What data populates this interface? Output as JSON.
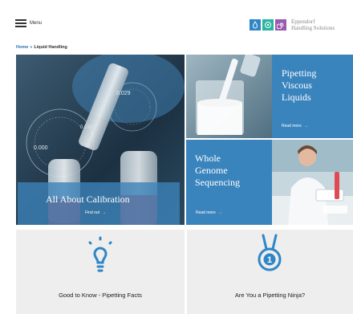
{
  "header": {
    "menu_label": "Menu",
    "brand_line1": "Eppendorf",
    "brand_line2": "Handling Solutions",
    "brand_colors": [
      "#2f86c6",
      "#2bb5a0",
      "#9b5bb0"
    ],
    "brand_icons": [
      "drop-icon",
      "target-icon",
      "spiral-icon"
    ]
  },
  "breadcrumb": {
    "home": "Home",
    "separator": "»",
    "current": "Liquid Handling"
  },
  "tiles": {
    "calibration": {
      "title": "All About Calibration",
      "link": "Find out",
      "arrow": "→"
    },
    "viscous": {
      "title_line1": "Pipetting",
      "title_line2": "Viscous",
      "title_line3": "Liquids",
      "link": "Read more",
      "arrow": "→"
    },
    "sequencing": {
      "title_line1": "Whole",
      "title_line2": "Genome",
      "title_line3": "Sequencing",
      "link": "Read more",
      "arrow": "→"
    }
  },
  "cards": {
    "facts": {
      "label": "Good to Know - Pipetting Facts",
      "icon": "lightbulb-icon"
    },
    "ninja": {
      "label": "Are You a Pipetting Ninja?",
      "icon": "medal-icon",
      "medal_number": "1"
    }
  },
  "colors": {
    "accent": "#3a84bd",
    "link": "#2e6fb0",
    "card_bg": "#eeeeee"
  }
}
